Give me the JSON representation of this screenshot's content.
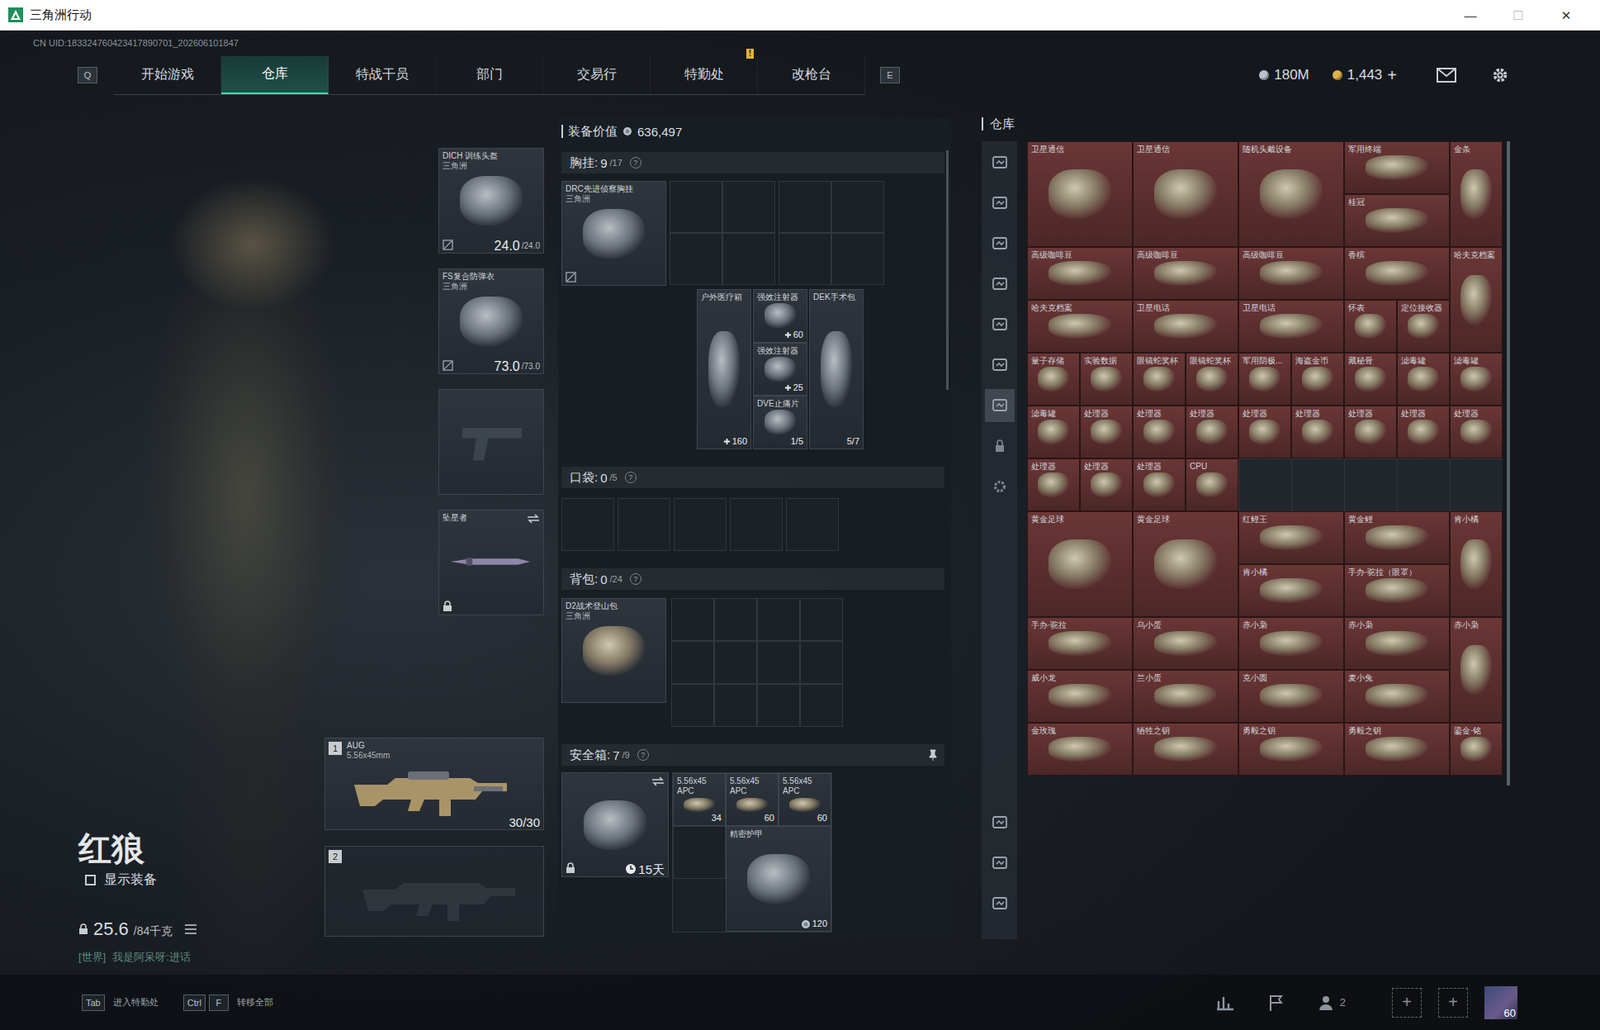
{
  "window": {
    "title": "三角洲行动",
    "controls": [
      "—",
      "☐",
      "✕"
    ]
  },
  "uid": "CN UID:183324760423417890701_202606101847",
  "nav": {
    "prev_key": "Q",
    "next_key": "E",
    "tabs": [
      {
        "label": "开始游戏",
        "selected": false
      },
      {
        "label": "仓库",
        "selected": true
      },
      {
        "label": "特战干员",
        "selected": false
      },
      {
        "label": "部门",
        "selected": false
      },
      {
        "label": "交易行",
        "selected": false
      },
      {
        "label": "特勤处",
        "selected": false,
        "badge": "!"
      },
      {
        "label": "改枪台",
        "selected": false
      }
    ],
    "currencies": [
      {
        "value": "180M",
        "color": "#b9c2cc"
      },
      {
        "value": "1,443",
        "color": "#e0b04a",
        "action": "+"
      }
    ]
  },
  "operator": {
    "name": "红狼",
    "show_equipment": {
      "label": "显示装备",
      "checked": false
    },
    "weight": {
      "value": "25.6",
      "max": "/84千克"
    },
    "chat": {
      "channel": "[世界]",
      "text": "我是阿呆呀:进话"
    }
  },
  "equipment": [
    {
      "kind": "gear",
      "name": "DICH 训练头盔",
      "brand": "三角洲",
      "durability": "24.0",
      "max": "/24.0"
    },
    {
      "kind": "gear",
      "name": "FS复合防弹衣",
      "brand": "三角洲",
      "durability": "73.0",
      "max": "/73.0"
    },
    {
      "kind": "empty"
    },
    {
      "kind": "melee",
      "name": "坠星者",
      "locked": true
    }
  ],
  "weapons": [
    {
      "kind": "gun",
      "index": "1",
      "name": "AUG",
      "caliber": "5.56x45mm",
      "ammo": "30/30"
    },
    {
      "kind": "empty",
      "index": "2"
    }
  ],
  "loadout": {
    "value_label": "装备价值",
    "value": "636,497",
    "chest": {
      "label": "胸挂:",
      "count": "9",
      "capacity": "/17",
      "help": "?",
      "rig": {
        "name": "DRC先进侦察胸挂",
        "brand": "三角洲"
      },
      "items": [
        {
          "kind": "heal",
          "name": "户外医疗箱",
          "value": "160"
        },
        {
          "kind": "heal",
          "name": "强效注射器",
          "value": "60"
        },
        {
          "kind": "heal",
          "name": "强效注射器",
          "value": "25"
        },
        {
          "kind": "uses",
          "name": "DVE止痛片",
          "value": "1/5"
        },
        {
          "kind": "uses",
          "name": "DEK手术包",
          "value": "5/7"
        }
      ]
    },
    "pockets": {
      "label": "口袋:",
      "count": "0",
      "capacity": "/5",
      "help": "?",
      "slots": [
        {
          "filled": false
        },
        {
          "filled": false
        },
        {
          "filled": false
        },
        {
          "filled": false
        },
        {
          "filled": false
        }
      ]
    },
    "backpack": {
      "label": "背包:",
      "count": "0",
      "capacity": "/24",
      "help": "?",
      "bag": {
        "name": "D2战术登山包",
        "brand": "三角洲"
      },
      "slots": [
        {
          "filled": false
        },
        {
          "filled": false
        },
        {
          "filled": false
        },
        {
          "filled": false
        },
        {
          "filled": false
        },
        {
          "filled": false
        },
        {
          "filled": false
        },
        {
          "filled": false
        },
        {
          "filled": false
        },
        {
          "filled": false
        },
        {
          "filled": false
        },
        {
          "filled": false
        }
      ]
    },
    "safe": {
      "label": "安全箱:",
      "count": "7",
      "capacity": "/9",
      "help": "?",
      "timer": "15天",
      "items": [
        {
          "kind": "ammo",
          "name": "5.56x45 APC",
          "value": "34"
        },
        {
          "kind": "ammo",
          "name": "5.56x45 APC",
          "value": "60"
        },
        {
          "kind": "ammo",
          "name": "5.56x45 APC",
          "value": "60"
        },
        {
          "kind": "empty"
        },
        {
          "kind": "armor",
          "name": "精密护甲",
          "value": "120"
        }
      ]
    }
  },
  "warehouse": {
    "title": "仓库",
    "sidebar": [
      {
        "selected": false
      },
      {
        "selected": false
      },
      {
        "selected": false
      },
      {
        "selected": false
      },
      {
        "selected": false
      },
      {
        "selected": false
      },
      {
        "selected": true
      },
      {
        "selected": false
      },
      {
        "selected": false
      }
    ],
    "items": [
      {
        "kind": "item",
        "name": "卫星通信",
        "w": 2,
        "h": 2
      },
      {
        "kind": "item",
        "name": "卫星通信",
        "w": 2,
        "h": 2
      },
      {
        "kind": "item",
        "name": "随机头戴设备",
        "w": 2,
        "h": 2
      },
      {
        "kind": "item",
        "name": "军用终端",
        "w": 2,
        "h": 1
      },
      {
        "kind": "item",
        "name": "金条",
        "w": 1,
        "h": 2
      },
      {
        "kind": "item",
        "name": "桂冠",
        "w": 2,
        "h": 1
      },
      {
        "kind": "item",
        "name": "高级咖啡豆",
        "w": 2,
        "h": 1
      },
      {
        "kind": "item",
        "name": "高级咖啡豆",
        "w": 2,
        "h": 1
      },
      {
        "kind": "item",
        "name": "高级咖啡豆",
        "w": 2,
        "h": 1
      },
      {
        "kind": "item",
        "name": "香槟",
        "w": 2,
        "h": 1
      },
      {
        "kind": "item",
        "name": "哈夫克档案",
        "w": 1,
        "h": 2
      },
      {
        "kind": "item",
        "name": "哈夫克档案",
        "w": 2,
        "h": 1
      },
      {
        "kind": "item",
        "name": "卫星电话",
        "w": 2,
        "h": 1
      },
      {
        "kind": "item",
        "name": "卫星电话",
        "w": 2,
        "h": 1
      },
      {
        "kind": "item",
        "name": "怀表",
        "w": 1,
        "h": 1
      },
      {
        "kind": "item",
        "name": "定位接收器",
        "w": 1,
        "h": 1
      },
      {
        "kind": "item",
        "name": "量子存储",
        "w": 1,
        "h": 1
      },
      {
        "kind": "item",
        "name": "实验数据",
        "w": 1,
        "h": 1
      },
      {
        "kind": "item",
        "name": "眼镜蛇奖杯",
        "w": 1,
        "h": 1
      },
      {
        "kind": "item",
        "name": "眼镜蛇奖杯",
        "w": 1,
        "h": 1
      },
      {
        "kind": "item",
        "name": "军用阴极...",
        "w": 1,
        "h": 1
      },
      {
        "kind": "item",
        "name": "海盗金币",
        "w": 1,
        "h": 1
      },
      {
        "kind": "item",
        "name": "藏秘骨",
        "w": 1,
        "h": 1
      },
      {
        "kind": "item",
        "name": "滤毒罐",
        "w": 1,
        "h": 1
      },
      {
        "kind": "item",
        "name": "滤毒罐",
        "w": 1,
        "h": 1
      },
      {
        "kind": "item",
        "name": "滤毒罐",
        "w": 1,
        "h": 1
      },
      {
        "kind": "item",
        "name": "处理器",
        "w": 1,
        "h": 1
      },
      {
        "kind": "item",
        "name": "处理器",
        "w": 1,
        "h": 1
      },
      {
        "kind": "item",
        "name": "处理器",
        "w": 1,
        "h": 1
      },
      {
        "kind": "item",
        "name": "处理器",
        "w": 1,
        "h": 1
      },
      {
        "kind": "item",
        "name": "处理器",
        "w": 1,
        "h": 1
      },
      {
        "kind": "item",
        "name": "处理器",
        "w": 1,
        "h": 1
      },
      {
        "kind": "item",
        "name": "处理器",
        "w": 1,
        "h": 1
      },
      {
        "kind": "item",
        "name": "处理器",
        "w": 1,
        "h": 1
      },
      {
        "kind": "item",
        "name": "处理器",
        "w": 1,
        "h": 1
      },
      {
        "kind": "item",
        "name": "处理器",
        "w": 1,
        "h": 1
      },
      {
        "kind": "item",
        "name": "处理器",
        "w": 1,
        "h": 1
      },
      {
        "kind": "item",
        "name": "CPU",
        "w": 1,
        "h": 1
      },
      {
        "kind": "empty",
        "w": 1,
        "h": 1
      },
      {
        "kind": "empty",
        "w": 1,
        "h": 1
      },
      {
        "kind": "empty",
        "w": 1,
        "h": 1
      },
      {
        "kind": "empty",
        "w": 1,
        "h": 1
      },
      {
        "kind": "empty",
        "w": 1,
        "h": 1
      },
      {
        "kind": "item",
        "name": "黄金足球",
        "w": 2,
        "h": 2
      },
      {
        "kind": "item",
        "name": "黄金足球",
        "w": 2,
        "h": 2
      },
      {
        "kind": "item",
        "name": "红鲤王",
        "w": 2,
        "h": 1
      },
      {
        "kind": "item",
        "name": "黄金鲤",
        "w": 2,
        "h": 1
      },
      {
        "kind": "item",
        "name": "肯小橘",
        "w": 1,
        "h": 2
      },
      {
        "kind": "item",
        "name": "肯小橘",
        "w": 2,
        "h": 1
      },
      {
        "kind": "item",
        "name": "手办·驼拉（眼罩）",
        "w": 2,
        "h": 1
      },
      {
        "kind": "item",
        "name": "手办·驼拉",
        "w": 2,
        "h": 1
      },
      {
        "kind": "item",
        "name": "乌小蛋",
        "w": 2,
        "h": 1
      },
      {
        "kind": "item",
        "name": "赤小枭",
        "w": 2,
        "h": 1
      },
      {
        "kind": "item",
        "name": "赤小枭",
        "w": 2,
        "h": 1
      },
      {
        "kind": "item",
        "name": "赤小枭",
        "w": 1,
        "h": 2
      },
      {
        "kind": "item",
        "name": "威小龙",
        "w": 2,
        "h": 1
      },
      {
        "kind": "item",
        "name": "兰小蛋",
        "w": 2,
        "h": 1
      },
      {
        "kind": "item",
        "name": "克小圆",
        "w": 2,
        "h": 1
      },
      {
        "kind": "item",
        "name": "麦小兔",
        "w": 2,
        "h": 1
      },
      {
        "kind": "item",
        "name": "金玫瑰",
        "w": 2,
        "h": 1
      },
      {
        "kind": "item",
        "name": "牺牲之钥",
        "w": 2,
        "h": 1
      },
      {
        "kind": "item",
        "name": "勇毅之钥",
        "w": 2,
        "h": 1
      },
      {
        "kind": "item",
        "name": "勇毅之钥",
        "w": 2,
        "h": 1
      },
      {
        "kind": "item",
        "name": "鎏金·铭",
        "w": 1,
        "h": 1
      }
    ]
  },
  "bottom": {
    "hints": [
      {
        "keys": [
          "Tab"
        ],
        "label": "进入特勤处"
      },
      {
        "keys": [
          "Ctrl",
          "F"
        ],
        "label": "转移全部"
      }
    ],
    "friends": "2",
    "slots": [
      "+",
      "+"
    ],
    "level": "60"
  }
}
